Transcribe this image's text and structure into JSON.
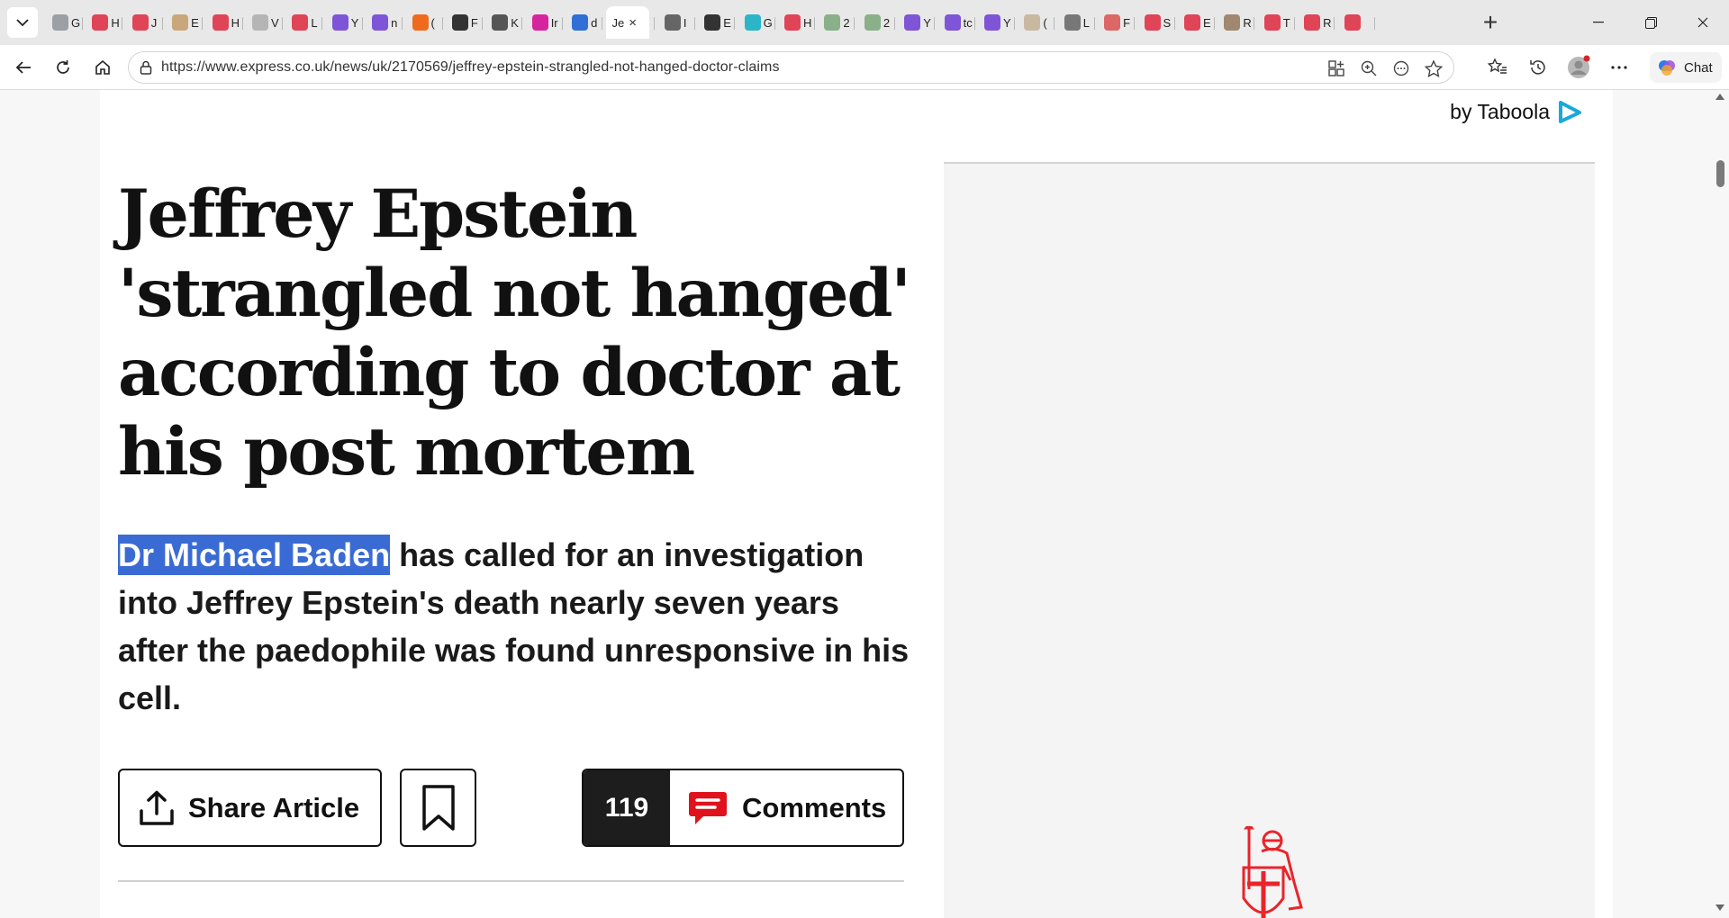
{
  "tabs": [
    {
      "letter": "G",
      "icon": "globe-icon",
      "color": "#9aa0a6"
    },
    {
      "letter": "H",
      "icon": "youtube-icon",
      "color": "#e04457"
    },
    {
      "letter": "J",
      "icon": "youtube-icon",
      "color": "#e04457"
    },
    {
      "letter": "E",
      "icon": "circle-logo-icon",
      "color": "#c9a77a"
    },
    {
      "letter": "H",
      "icon": "youtube-icon",
      "color": "#e04457"
    },
    {
      "letter": "V",
      "icon": "page-icon",
      "color": "#b5b5b5"
    },
    {
      "letter": "L",
      "icon": "youtube-icon",
      "color": "#e04457"
    },
    {
      "letter": "Y",
      "icon": "purple-slash-icon",
      "color": "#7e55d6"
    },
    {
      "letter": "n",
      "icon": "yahoo-icon",
      "color": "#7e55d6"
    },
    {
      "letter": "(",
      "icon": "orange-book-icon",
      "color": "#f06a1d"
    },
    {
      "letter": "F",
      "icon": "fp-icon",
      "color": "#333333"
    },
    {
      "letter": "K",
      "icon": "r-logo-icon",
      "color": "#555555"
    },
    {
      "letter": "Ir",
      "icon": "instagram-icon",
      "color": "#d6249f"
    },
    {
      "letter": "d",
      "icon": "search-icon",
      "color": "#2f6fd6"
    },
    {
      "letter": "Je",
      "icon": "",
      "color": "#ffffff",
      "active": true
    },
    {
      "letter": "I",
      "icon": "diamond-icon",
      "color": "#666666"
    },
    {
      "letter": "E",
      "icon": "nyt-icon",
      "color": "#333333"
    },
    {
      "letter": "G",
      "icon": "snowflake-icon",
      "color": "#2bb5c8"
    },
    {
      "letter": "H",
      "icon": "youtube-icon",
      "color": "#e04457"
    },
    {
      "letter": "2",
      "icon": "photo-icon",
      "color": "#8ab08a"
    },
    {
      "letter": "2",
      "icon": "photo-icon",
      "color": "#8ab08a"
    },
    {
      "letter": "Y",
      "icon": "yahoo-icon",
      "color": "#7e55d6"
    },
    {
      "letter": "tc",
      "icon": "yahoo-icon",
      "color": "#7e55d6"
    },
    {
      "letter": "Y",
      "icon": "purple-slash-icon",
      "color": "#7e55d6"
    },
    {
      "letter": "(",
      "icon": "portrait-icon",
      "color": "#c9b8a0"
    },
    {
      "letter": "L",
      "icon": "info-icon",
      "color": "#777777"
    },
    {
      "letter": "F",
      "icon": "bird-icon",
      "color": "#d66"
    },
    {
      "letter": "S",
      "icon": "youtube-icon",
      "color": "#e04457"
    },
    {
      "letter": "E",
      "icon": "youtube-icon",
      "color": "#e04457"
    },
    {
      "letter": "R",
      "icon": "photo-icon",
      "color": "#a08870"
    },
    {
      "letter": "T",
      "icon": "youtube-icon",
      "color": "#e04457"
    },
    {
      "letter": "R",
      "icon": "youtube-icon",
      "color": "#e04457"
    },
    {
      "letter": "",
      "icon": "youtube-icon",
      "color": "#e04457"
    }
  ],
  "active_tab_close": "×",
  "new_tab_label": "+",
  "url": "https://www.express.co.uk/news/uk/2170569/jeffrey-epstein-strangled-not-hanged-doctor-claims",
  "chat_label": "Chat",
  "taboola_label": "by Taboola",
  "article": {
    "headline": "Jeffrey Epstein 'strangled not hanged' according to doctor at his post mortem",
    "standfirst_highlight": "Dr Michael Baden",
    "standfirst_rest": " has called for an investigation into Jeffrey Epstein's death nearly seven years after the paedophile was found unresponsive in his cell.",
    "share_label": "Share Article",
    "comment_count": "119",
    "comments_label": "Comments"
  },
  "colors": {
    "highlight": "#3a6bd4",
    "comment_icon": "#e0121b",
    "knight": "#e8252b"
  }
}
